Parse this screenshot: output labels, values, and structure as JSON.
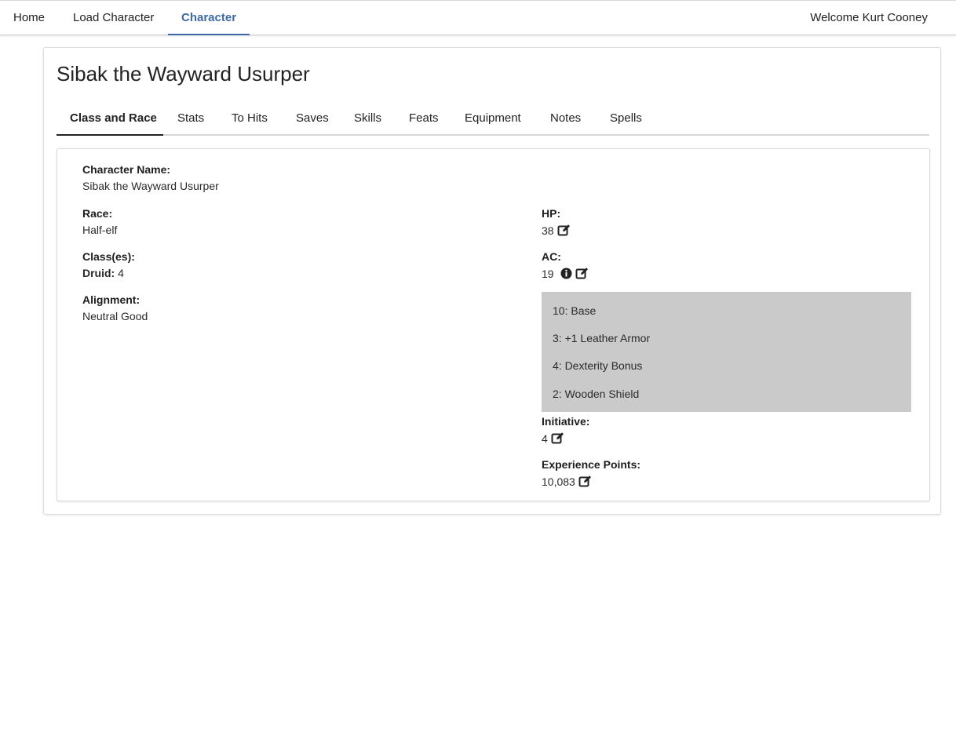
{
  "nav": {
    "items": [
      {
        "label": "Home"
      },
      {
        "label": "Load Character"
      },
      {
        "label": "Character"
      }
    ],
    "welcome": "Welcome Kurt Cooney"
  },
  "character": {
    "title": "Sibak the Wayward Usurper",
    "tabs": [
      {
        "label": "Class and Race"
      },
      {
        "label": "Stats"
      },
      {
        "label": "To Hits"
      },
      {
        "label": "Saves"
      },
      {
        "label": "Skills"
      },
      {
        "label": "Feats"
      },
      {
        "label": "Equipment"
      },
      {
        "label": "Notes"
      },
      {
        "label": "Spells"
      }
    ],
    "active_tab": "Class and Race"
  },
  "class_and_race": {
    "name_label": "Character Name:",
    "name_value": "Sibak the Wayward Usurper",
    "race_label": "Race:",
    "race_value": "Half-elf",
    "classes_label": "Class(es):",
    "classes": [
      {
        "name": "Druid:",
        "level": "4"
      }
    ],
    "alignment_label": "Alignment:",
    "alignment_value": "Neutral Good",
    "hp_label": "HP:",
    "hp_value": "38",
    "ac_label": "AC:",
    "ac_value": "19",
    "ac_breakdown": [
      "10: Base",
      "3: +1 Leather Armor",
      "4: Dexterity Bonus",
      "2: Wooden Shield"
    ],
    "initiative_label": "Initiative:",
    "initiative_value": "4",
    "xp_label": "Experience Points:",
    "xp_value": "10,083"
  },
  "icons": {
    "edit": "edit-icon",
    "info": "info-icon"
  },
  "colors": {
    "accent": "#3d6aa5",
    "ac_breakdown_bg": "#cacaca"
  }
}
